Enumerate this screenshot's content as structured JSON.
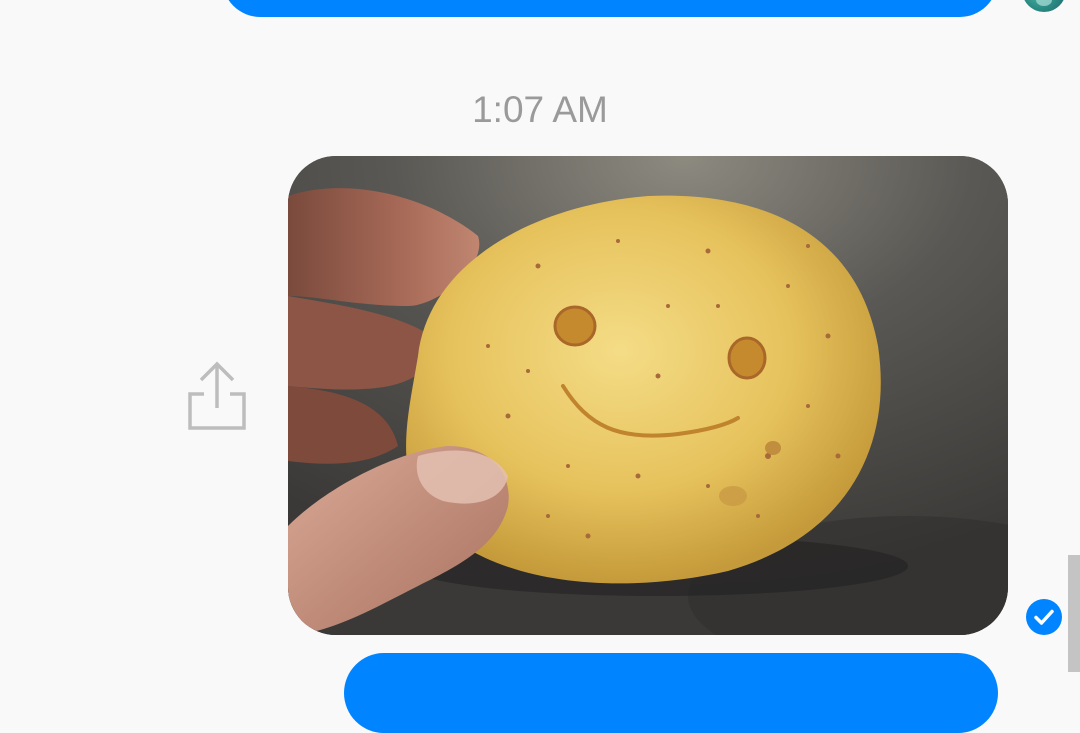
{
  "conversation": {
    "timestamp": "1:07 AM",
    "messages": [
      {
        "kind": "text-bubble",
        "text": "",
        "outgoing": true
      },
      {
        "kind": "photo",
        "icon": "smiley-potato-photo",
        "outgoing": true,
        "status": "sent"
      },
      {
        "kind": "text-bubble",
        "text": "",
        "outgoing": true
      }
    ]
  },
  "icons": {
    "share": "share-icon",
    "sent": "check-icon"
  },
  "colors": {
    "bubble": "#0084ff",
    "status_circle": "#0084ff",
    "timestamp_text": "#9a9a9a",
    "background": "#f9f9f9"
  }
}
